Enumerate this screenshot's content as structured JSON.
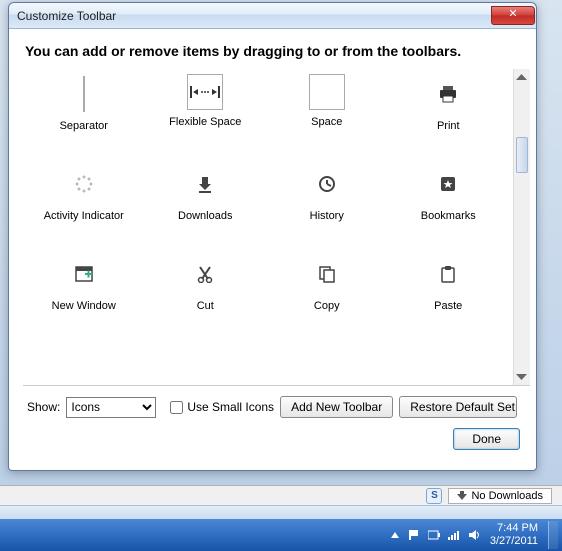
{
  "window": {
    "title": "Customize Toolbar",
    "instruction": "You can add or remove items by dragging to or from the toolbars."
  },
  "items": [
    {
      "label": "Separator",
      "icon": "separator"
    },
    {
      "label": "Flexible Space",
      "icon": "flex-space"
    },
    {
      "label": "Space",
      "icon": "space"
    },
    {
      "label": "Print",
      "icon": "print"
    },
    {
      "label": "Activity Indicator",
      "icon": "activity"
    },
    {
      "label": "Downloads",
      "icon": "downloads"
    },
    {
      "label": "History",
      "icon": "history"
    },
    {
      "label": "Bookmarks",
      "icon": "bookmarks"
    },
    {
      "label": "New Window",
      "icon": "new-window"
    },
    {
      "label": "Cut",
      "icon": "cut"
    },
    {
      "label": "Copy",
      "icon": "copy"
    },
    {
      "label": "Paste",
      "icon": "paste"
    }
  ],
  "controls": {
    "show_label": "Show:",
    "show_value": "Icons",
    "use_small_label": "Use Small Icons",
    "use_small_checked": false,
    "add_toolbar": "Add New Toolbar",
    "restore_default": "Restore Default Set",
    "done": "Done"
  },
  "status": {
    "s_badge": "S",
    "no_downloads": "No Downloads"
  },
  "tray": {
    "time": "7:44 PM",
    "date": "3/27/2011"
  }
}
